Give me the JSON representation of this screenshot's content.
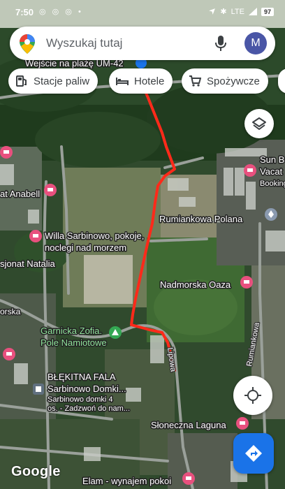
{
  "status_bar": {
    "time": "7:50",
    "left_icons": "◎ ◎ ◎ •",
    "network": "LTE",
    "battery": "97"
  },
  "search": {
    "placeholder": "Wyszukaj tutaj",
    "avatar_letter": "M"
  },
  "chips": [
    {
      "label": "Stacje paliw",
      "icon": "gas-station-icon"
    },
    {
      "label": "Hotele",
      "icon": "bed-icon"
    },
    {
      "label": "Spożywcze",
      "icon": "cart-icon"
    }
  ],
  "map_labels": {
    "beach_entry": "Wejście na plażę UM-42",
    "anabell": "at Anabell",
    "willa_line1": "Willa Sarbinowo, pokoje,",
    "willa_line2": "noclegi nad morzem",
    "natalia": "sjonat Natalia",
    "rumiankowa_polana": "Rumiankowa Polana",
    "nadmorska_oaza": "Nadmorska Oaza",
    "sun_b_line1": "Sun B",
    "sun_b_line2": "Vacat",
    "booking": "Booking",
    "morska": "orska",
    "garnicka_line1": "Garnicka Zofia.",
    "garnicka_line2": "Pole Namiotowe",
    "blekitna_line1": "BŁĘKITNA FALA",
    "blekitna_line2": "Sarbinowo Domki...",
    "domki_line1": "Sarbinowo domki 4",
    "domki_line2": "os. - Zadzwoń do nam...",
    "sloneczna": "Słoneczna Laguna",
    "elam": "Elam - wynajem pokoi",
    "street_lipowa": "Lipowa",
    "street_rumiankowa": "Rumiankowa",
    "google": "Google"
  },
  "colors": {
    "route": "#ff2a1a",
    "accent_blue": "#1a73e8",
    "hotel_pin": "#e8507e",
    "campsite_pin": "#34a853",
    "search_text": "#5f6368",
    "avatar_bg": "#4a56a6"
  }
}
